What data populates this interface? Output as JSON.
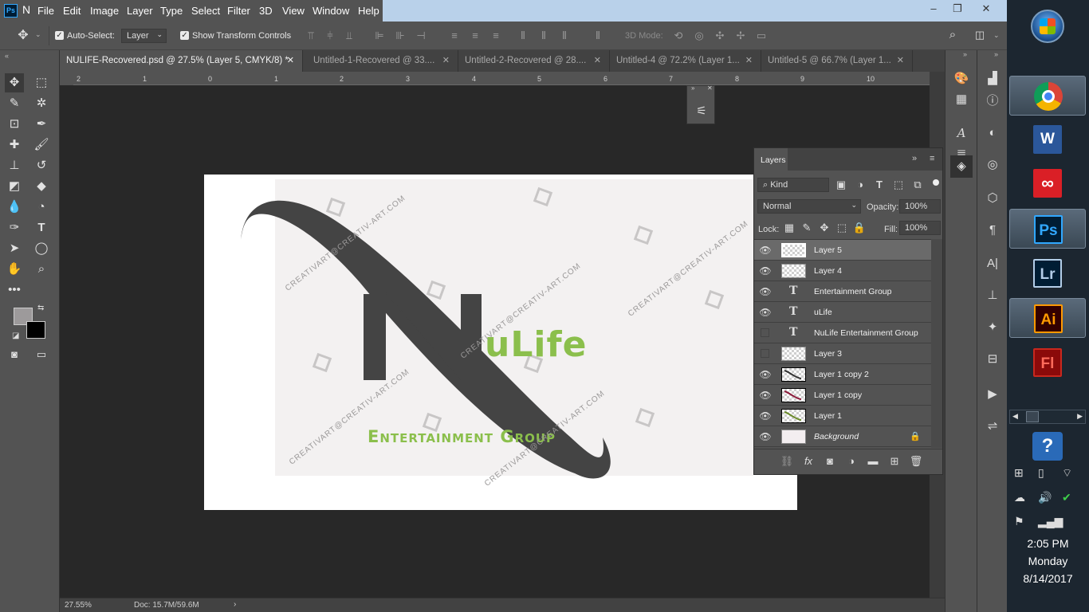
{
  "menubar": {
    "app_letter": "N",
    "items": [
      "File",
      "Edit",
      "Image",
      "Layer",
      "Type",
      "Select",
      "Filter",
      "3D",
      "View",
      "Window",
      "Help"
    ],
    "controls": [
      "–",
      "❐",
      "✕"
    ]
  },
  "options": {
    "auto_select_label": "Auto-Select:",
    "auto_select_value": "Layer",
    "show_transform_label": "Show Transform Controls",
    "mode_3d_label": "3D Mode:"
  },
  "tabs": [
    {
      "label": "NULIFE-Recovered.psd @ 27.5% (Layer 5, CMYK/8) *",
      "active": true
    },
    {
      "label": "Untitled-1-Recovered @ 33....",
      "active": false
    },
    {
      "label": "Untitled-2-Recovered @ 28....",
      "active": false
    },
    {
      "label": "Untitled-4 @ 72.2% (Layer 1...",
      "active": false
    },
    {
      "label": "Untitled-5 @ 66.7% (Layer 1...",
      "active": false
    }
  ],
  "ruler": {
    "h": [
      "2",
      "1",
      "0",
      "1",
      "2",
      "3",
      "4",
      "5",
      "6",
      "7",
      "8",
      "9",
      "10"
    ],
    "v": [
      "1",
      "0",
      "1",
      "2",
      "3",
      "4",
      "5",
      "6"
    ]
  },
  "artwork": {
    "title_main": "uLife",
    "subtitle": "Entertainment Group",
    "watermark": "CREATIVART@CREATIV-ART.COM",
    "colors": {
      "green": "#8bbf4c",
      "dark": "#444444",
      "paper": "#f3f1f1"
    }
  },
  "status": {
    "zoom": "27.55%",
    "doc": "Doc: 15.7M/59.6M"
  },
  "layers_panel": {
    "title": "Layers",
    "kind_label": "Kind",
    "blend_mode": "Normal",
    "opacity_label": "Opacity:",
    "opacity_value": "100%",
    "lock_label": "Lock:",
    "fill_label": "Fill:",
    "fill_value": "100%",
    "layers": [
      {
        "name": "Layer 5",
        "visible": true,
        "type": "pixel",
        "selected": true
      },
      {
        "name": "Layer 4",
        "visible": true,
        "type": "pixel",
        "selected": false
      },
      {
        "name": "Entertainment Group",
        "visible": true,
        "type": "text",
        "selected": false
      },
      {
        "name": "uLife",
        "visible": true,
        "type": "text",
        "selected": false
      },
      {
        "name": "NuLife Entertainment Group",
        "visible": false,
        "type": "text",
        "selected": false
      },
      {
        "name": "Layer 3",
        "visible": false,
        "type": "pixel",
        "selected": false
      },
      {
        "name": "Layer 1 copy 2",
        "visible": true,
        "type": "shape",
        "selected": false
      },
      {
        "name": "Layer 1 copy",
        "visible": true,
        "type": "shape",
        "selected": false
      },
      {
        "name": "Layer 1",
        "visible": true,
        "type": "shape",
        "selected": false
      },
      {
        "name": "Background",
        "visible": true,
        "type": "background",
        "selected": false
      }
    ]
  },
  "taskbar": {
    "apps": [
      {
        "name": "Chrome",
        "label": ""
      },
      {
        "name": "Word",
        "label": "W"
      },
      {
        "name": "Creative Cloud",
        "label": ""
      },
      {
        "name": "Photoshop",
        "label": "Ps"
      },
      {
        "name": "Lightroom",
        "label": "Lr"
      },
      {
        "name": "Illustrator",
        "label": "Ai"
      },
      {
        "name": "Flash",
        "label": "Fl"
      }
    ],
    "time": "2:05 PM",
    "day": "Monday",
    "date": "8/14/2017"
  }
}
